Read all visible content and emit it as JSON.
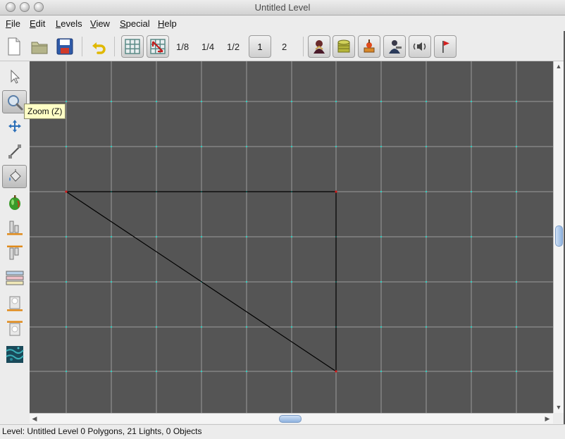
{
  "window": {
    "title": "Untitled Level"
  },
  "menubar": [
    {
      "label": "File",
      "mnemonic": "F",
      "rest": "ile"
    },
    {
      "label": "Edit",
      "mnemonic": "E",
      "rest": "dit"
    },
    {
      "label": "Levels",
      "mnemonic": "L",
      "rest": "evels"
    },
    {
      "label": "View",
      "mnemonic": "V",
      "rest": "iew"
    },
    {
      "label": "Special",
      "mnemonic": "S",
      "rest": "pecial"
    },
    {
      "label": "Help",
      "mnemonic": "H",
      "rest": "elp"
    }
  ],
  "toolbar": {
    "zoom_levels": [
      "1/8",
      "1/4",
      "1/2",
      "1",
      "2"
    ],
    "selected_zoom": "1"
  },
  "tooltip": {
    "text": "Zoom (Z)"
  },
  "status": {
    "text": "Level: Untitled Level  0 Polygons, 21 Lights, 0 Objects"
  },
  "colors": {
    "canvas": "#555555",
    "grid": "#9a9a9a",
    "grid_point": "#2fd0c0",
    "vertex": "#d01a1a",
    "line": "#000000"
  }
}
